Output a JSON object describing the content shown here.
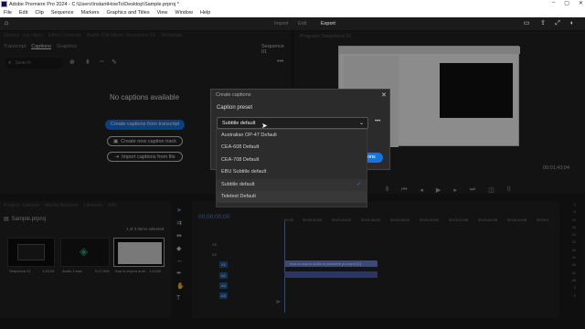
{
  "titlebar": {
    "title": "Adobe Premiere Pro 2024 - C:\\Users\\InstantHowTo\\Desktop\\Sample.prproj *",
    "min": "–",
    "max": "▢",
    "close": "✕"
  },
  "menu": [
    "File",
    "Edit",
    "Clip",
    "Sequence",
    "Markers",
    "Graphics and Titles",
    "View",
    "Window",
    "Help"
  ],
  "workspace": {
    "tabs": [
      "Import",
      "Edit",
      "Export"
    ]
  },
  "left_panel": {
    "tabs_top": [
      "Source: (no clips)",
      "Effect Controls",
      "Audio Clip Mixer: Sequence 01",
      "Metadata"
    ],
    "tabs": [
      "Transcript",
      "Captions",
      "Graphics"
    ],
    "sequence_label": "Sequence 01",
    "search_placeholder": "Search",
    "no_captions": "No captions available",
    "btn_create_transcript": "Create captions from transcript",
    "btn_new_track": "Create new caption track",
    "btn_import": "Import captions from file"
  },
  "program": {
    "title": "Program: Sequence 01",
    "timecode": "00;01;43;04"
  },
  "dialog": {
    "title": "Create captions",
    "preset_label": "Caption preset",
    "preset_value": "Subtitle default",
    "options": [
      "Australian OP-47 Default",
      "CEA-608 Default",
      "CEA-708 Default",
      "EBU Subtitle default",
      "Subtitle default",
      "Teletext Default"
    ],
    "selected_index": 4,
    "button_partial": "tions"
  },
  "project": {
    "tabs": [
      "Project: Sample",
      "Media Browser",
      "Libraries",
      "Info"
    ],
    "file": "Sample.prproj",
    "selection": "1 of 3 items selected",
    "items": [
      {
        "name": "Sequence 01",
        "duration": "1;43;04"
      },
      {
        "name": "Audio 1.wav",
        "duration": "0;17;904"
      },
      {
        "name": "how to export audi...",
        "duration": "1;43;56"
      }
    ]
  },
  "timeline": {
    "timecode": "00;00;00;00",
    "ruler": [
      ":00;00",
      "00;00;32;00",
      "00;01;04;02",
      "00;01;36;02",
      "00;02;08;04",
      "00;02;40;04",
      "00;03;12;06",
      "00;03;44;06",
      "00;04;16;08",
      "00;04;4"
    ],
    "tracks": [
      "V3",
      "V2",
      "V1",
      "A1",
      "A2",
      "A3"
    ],
    "clip_v": "how to export audio in premiere pro.mp4 [V]",
    "meter_labels": [
      "0",
      "-6",
      "-12",
      "-18",
      "-24",
      "-30",
      "-36",
      "-42",
      "-48",
      "-54",
      "-dB",
      "S",
      "S"
    ]
  }
}
